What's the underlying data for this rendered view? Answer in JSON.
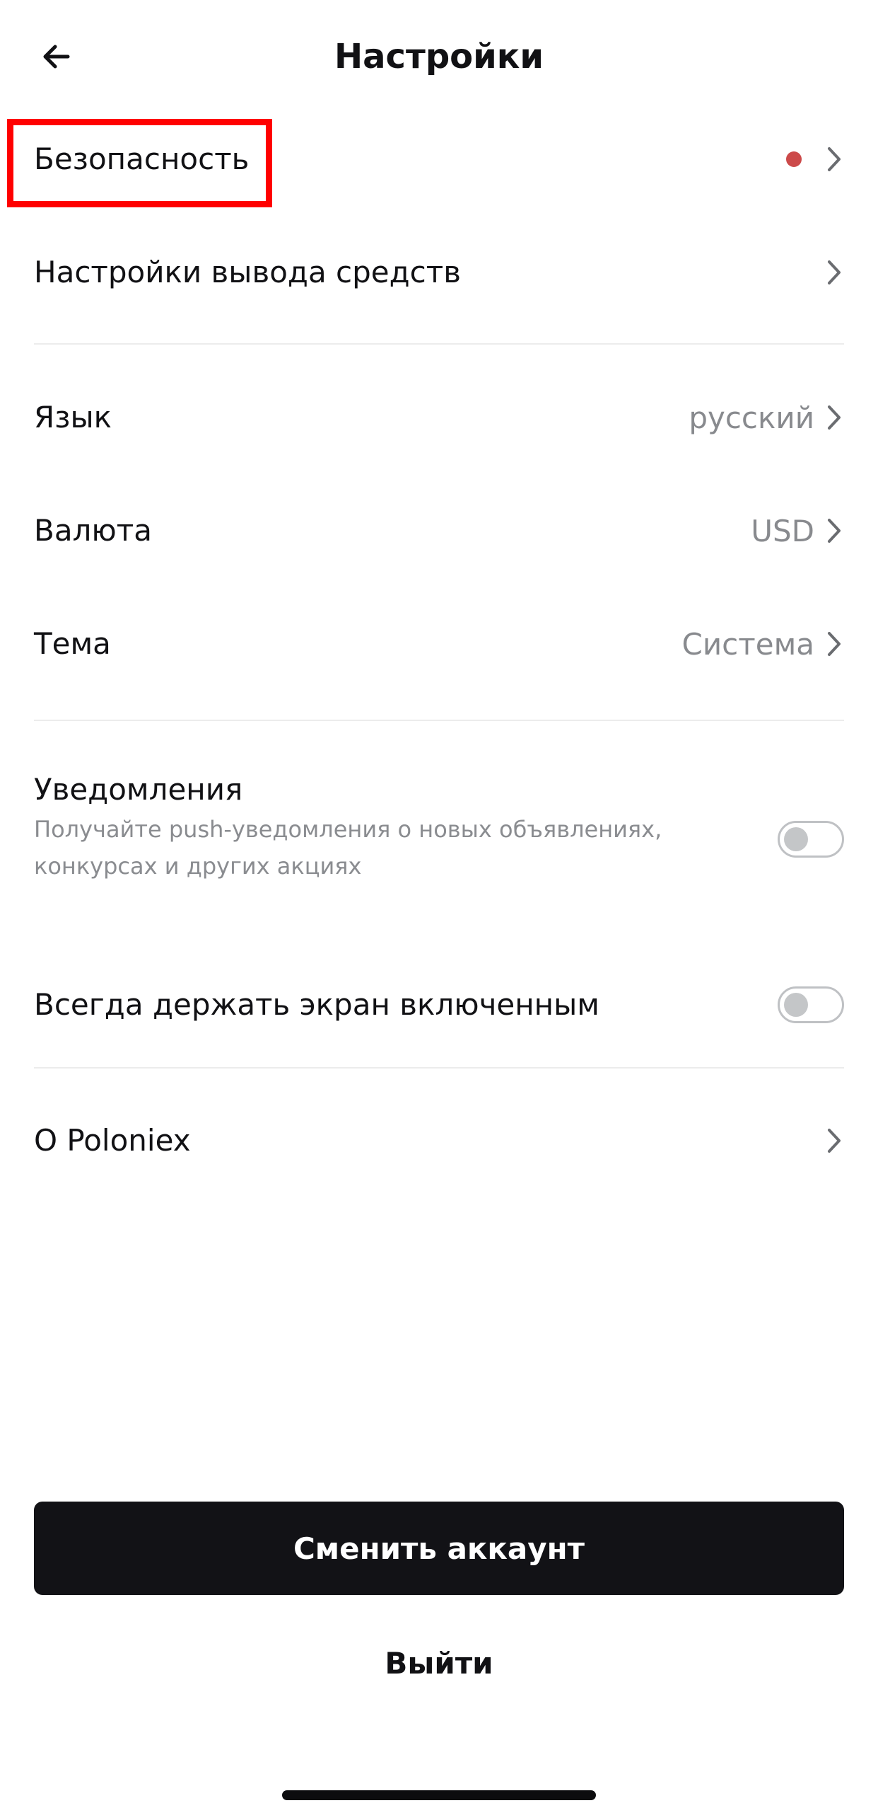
{
  "header": {
    "title": "Настройки",
    "back_icon": "arrow-left-icon"
  },
  "sections": {
    "security": {
      "label": "Безопасность",
      "has_alert_dot": true,
      "alert_color": "#cc4a4a"
    },
    "withdraw": {
      "label": "Настройки вывода средств"
    },
    "language": {
      "label": "Язык",
      "value": "русский"
    },
    "currency": {
      "label": "Валюта",
      "value": "USD"
    },
    "theme": {
      "label": "Тема",
      "value": "Система"
    },
    "notifications": {
      "label": "Уведомления",
      "description": "Получайте push-уведомления о новых объявлениях, конкурсах и других акциях",
      "enabled": false
    },
    "keep_screen_on": {
      "label": "Всегда держать экран включенным",
      "enabled": false
    },
    "about": {
      "label": "О Poloniex"
    }
  },
  "buttons": {
    "switch_account": "Сменить аккаунт",
    "logout": "Выйти"
  },
  "colors": {
    "primary_button": "#121216",
    "highlight_box": "#ff0000"
  }
}
